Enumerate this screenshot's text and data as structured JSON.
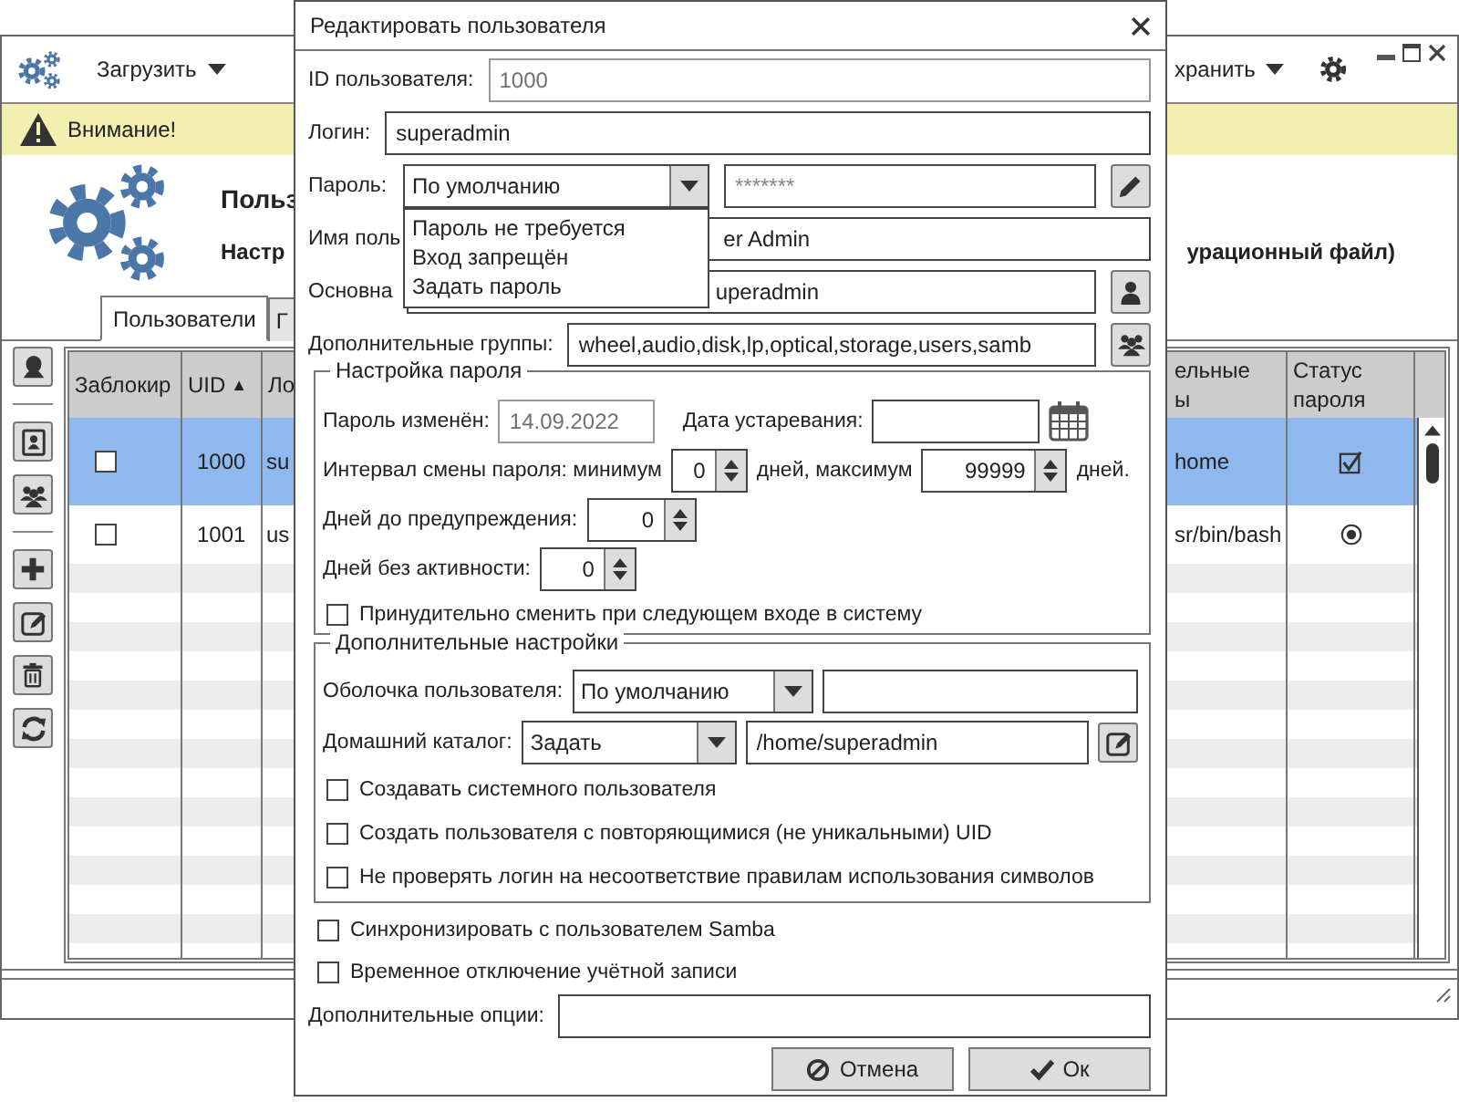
{
  "main_window": {
    "load_menu": "Загрузить",
    "save_menu": "хранить",
    "warning": "Внимание!",
    "title": "Польз",
    "subtitle": "Настр",
    "subtitle_end": "урационный файл)",
    "tabs": [
      {
        "label": "Пользователи",
        "selected": true
      },
      {
        "label": "Г",
        "selected": false
      }
    ],
    "table": {
      "columns": [
        {
          "lines": [
            "Заблокир"
          ]
        },
        {
          "lines": [
            "UID"
          ],
          "mark": "▲"
        },
        {
          "lines": [
            "Ло"
          ]
        },
        {
          "lines": [
            "ельные",
            "ы"
          ]
        },
        {
          "lines": [
            "Статус",
            "пароля"
          ]
        }
      ],
      "rows": [
        {
          "selected": true,
          "locked": false,
          "uid": "1000",
          "login": "su",
          "column_4": "home",
          "password_set": true
        },
        {
          "selected": false,
          "locked": false,
          "uid": "1001",
          "login": "us",
          "column_4": "sr/bin/bash",
          "password_set": false
        }
      ]
    }
  },
  "dialog": {
    "title": "Редактировать пользователя",
    "user_id": {
      "label": "ID пользователя:",
      "value": "1000",
      "disabled": true
    },
    "login": {
      "label": "Логин:",
      "value": "superadmin"
    },
    "password": {
      "label": "Пароль:",
      "mode": "По умолчанию",
      "placeholder": "*******",
      "expanded": true,
      "options": [
        "Пароль не требуется",
        "Вход запрещён",
        "Задать пароль"
      ]
    },
    "full_name": {
      "label": "Имя поль",
      "value": "er Admin"
    },
    "primary_group": {
      "label": "Основна",
      "value": "uperadmin"
    },
    "groups": {
      "label": "Дополнительные группы:",
      "value": "wheel,audio,disk,lp,optical,storage,users,samb"
    },
    "password_settings": {
      "title": "Настройка пароля",
      "changed_label": "Пароль изменён:",
      "changed_value": "14.09.2022",
      "changed_disabled": true,
      "expire_label": "Дата устаревания:",
      "interval_label": "Интервал смены пароля: минимум",
      "min_value": "0",
      "max_label": "дней, максимум",
      "max_value": "99999",
      "days_label": "дней.",
      "warn_label": "Дней до предупреждения:",
      "warn_value": "0",
      "inactive_label": "Дней без активности:",
      "inactive_value": "0",
      "force_change": {
        "label": "Принудительно сменить при следующем входе в систему",
        "checked": false
      }
    },
    "extra_settings": {
      "title": "Дополнительные настройки",
      "shell_label": "Оболочка пользователя:",
      "shell_mode": "По умолчанию",
      "home_label": "Домашний каталог:",
      "home_mode": "Задать",
      "home_value": "/home/superadmin",
      "options": [
        {
          "label": "Создавать системного пользователя",
          "checked": false
        },
        {
          "label": "Создать пользователя с повторяющимися (не уникальными) UID",
          "checked": false
        },
        {
          "label": "Не проверять логин на несоответствие правилам использования символов",
          "checked": false
        }
      ]
    },
    "options": [
      {
        "label": "Синхронизировать с пользователем Samba",
        "checked": false
      },
      {
        "label": "Временное отключение учётной записи",
        "checked": false
      }
    ],
    "extra_options_label": "Дополнительные опции:",
    "buttons": [
      {
        "kind": "cancel",
        "label": "Отмена"
      },
      {
        "kind": "ok",
        "label": "Ок"
      }
    ]
  }
}
